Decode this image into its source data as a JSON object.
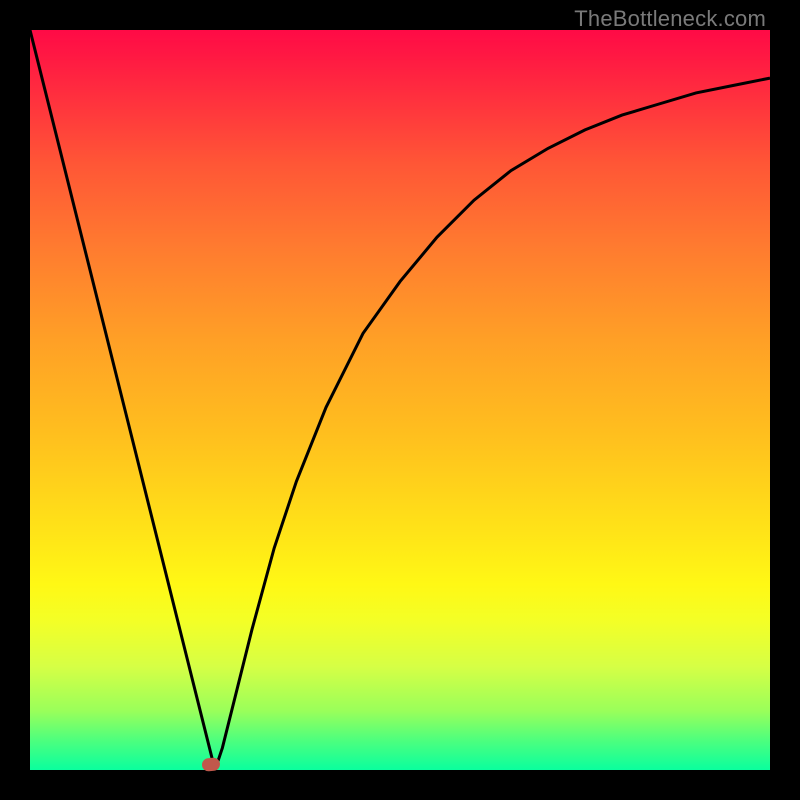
{
  "attribution": "TheBottleneck.com",
  "colors": {
    "top": "#ff0a46",
    "bottom": "#0aff9e",
    "curve": "#000000",
    "marker": "#c0584b",
    "frame": "#000000"
  },
  "chart_data": {
    "type": "line",
    "title": "",
    "xlabel": "",
    "ylabel": "",
    "xlim": [
      0,
      100
    ],
    "ylim": [
      0,
      100
    ],
    "x": [
      0,
      2,
      4,
      6,
      8,
      10,
      12,
      14,
      16,
      18,
      20,
      22,
      24,
      25,
      26,
      28,
      30,
      33,
      36,
      40,
      45,
      50,
      55,
      60,
      65,
      70,
      75,
      80,
      85,
      90,
      95,
      100
    ],
    "values": [
      100,
      92,
      84,
      76,
      68,
      60,
      52,
      44,
      36,
      28,
      20,
      12,
      4,
      0,
      3,
      11,
      19,
      30,
      39,
      49,
      59,
      66,
      72,
      77,
      81,
      84,
      86.5,
      88.5,
      90,
      91.5,
      92.5,
      93.5
    ],
    "minimum_x": 25,
    "marker": {
      "x": 24.5,
      "y": 0.4
    }
  }
}
